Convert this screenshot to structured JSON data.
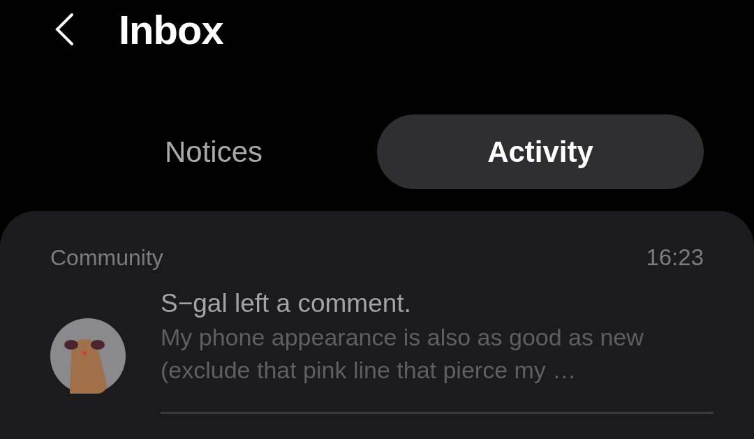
{
  "header": {
    "title": "Inbox"
  },
  "tabs": [
    {
      "label": "Notices",
      "selected": false
    },
    {
      "label": "Activity",
      "selected": true
    }
  ],
  "notifications": [
    {
      "category": "Community",
      "time": "16:23",
      "title": "S−gal left a comment.",
      "body": "My phone appearance is also as good as new (exclude that pink line that pierce my …"
    }
  ]
}
